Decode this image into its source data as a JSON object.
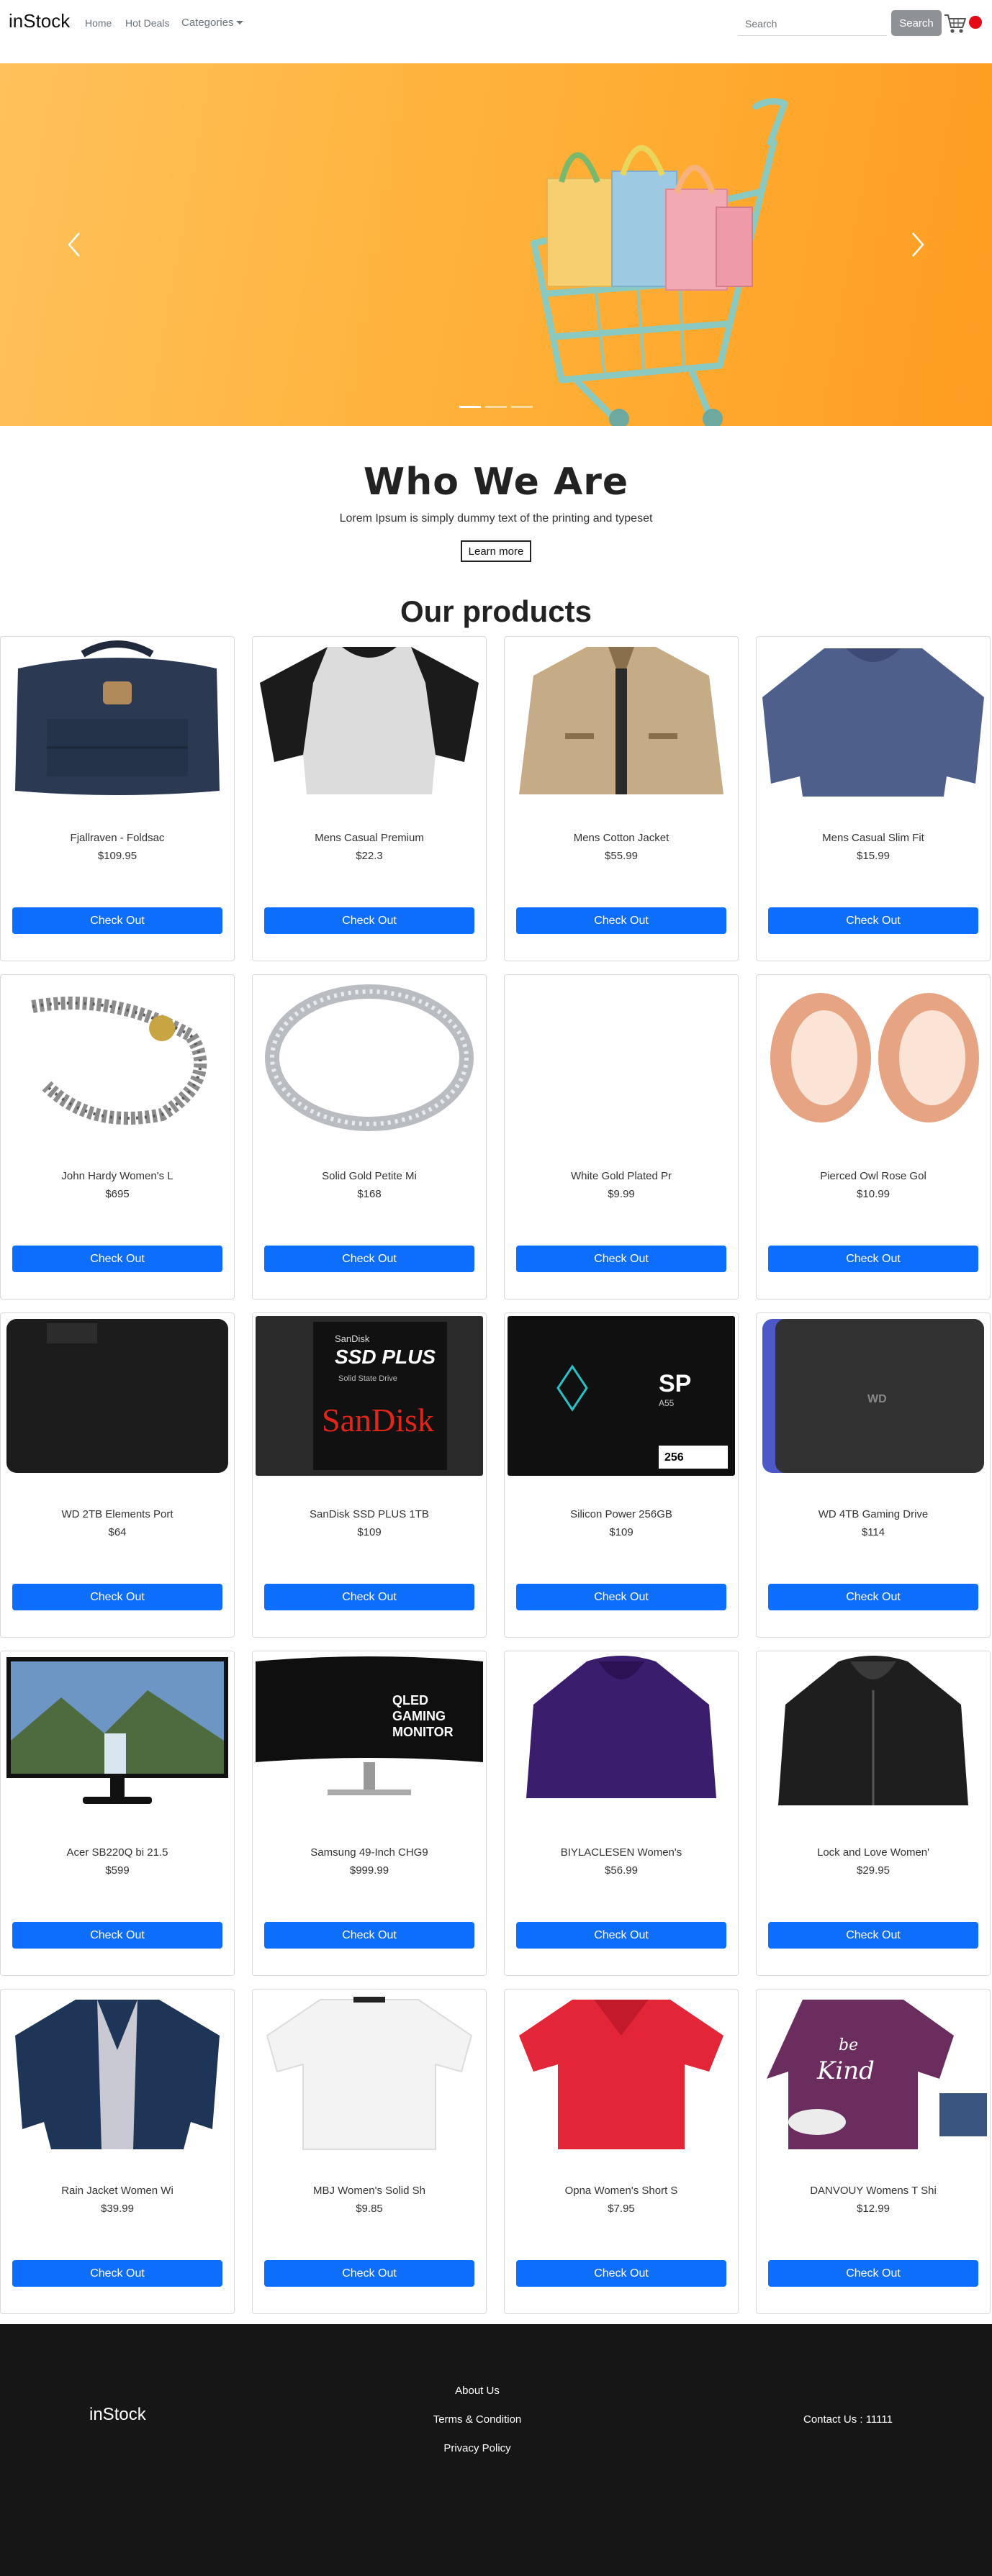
{
  "navbar": {
    "brand": "inStock",
    "links": {
      "home": "Home",
      "hot_deals": "Hot Deals",
      "categories": "Categories"
    },
    "search_placeholder": "Search",
    "search_button": "Search"
  },
  "about": {
    "title": "Who We Are",
    "text": "Lorem Ipsum is simply dummy text of the printing and typeset",
    "button": "Learn more"
  },
  "products_heading": "Our products",
  "checkout_label": "Check Out",
  "products": [
    {
      "title": "Fjallraven - Foldsac",
      "price": "$109.95"
    },
    {
      "title": "Mens Casual Premium",
      "price": "$22.3"
    },
    {
      "title": "Mens Cotton Jacket",
      "price": "$55.99"
    },
    {
      "title": "Mens Casual Slim Fit",
      "price": "$15.99"
    },
    {
      "title": "John Hardy Women's L",
      "price": "$695"
    },
    {
      "title": "Solid Gold Petite Mi",
      "price": "$168"
    },
    {
      "title": "White Gold Plated Pr",
      "price": "$9.99"
    },
    {
      "title": "Pierced Owl Rose Gol",
      "price": "$10.99"
    },
    {
      "title": "WD 2TB Elements Port",
      "price": "$64"
    },
    {
      "title": "SanDisk SSD PLUS 1TB",
      "price": "$109"
    },
    {
      "title": "Silicon Power 256GB",
      "price": "$109"
    },
    {
      "title": "WD 4TB Gaming Drive",
      "price": "$114"
    },
    {
      "title": "Acer SB220Q bi 21.5",
      "price": "$599"
    },
    {
      "title": "Samsung 49-Inch CHG9",
      "price": "$999.99"
    },
    {
      "title": "BIYLACLESEN Women's",
      "price": "$56.99"
    },
    {
      "title": "Lock and Love Women'",
      "price": "$29.95"
    },
    {
      "title": "Rain Jacket Women Wi",
      "price": "$39.99"
    },
    {
      "title": "MBJ Women's Solid Sh",
      "price": "$9.85"
    },
    {
      "title": "Opna Women's Short S",
      "price": "$7.95"
    },
    {
      "title": "DANVOUY Womens T Shi",
      "price": "$12.99"
    }
  ],
  "product_image_text": {
    "ssd_brand": "SanDisk",
    "ssd_model": "SSD PLUS",
    "ssd_sub": "Solid State Drive",
    "ssd_logo": "SanDisk",
    "sp_logo": "SP",
    "sp_model": "A55",
    "sp_capacity": "256",
    "wd_logo": "WD",
    "monitor_text_1": "QLED",
    "monitor_text_2": "GAMING",
    "monitor_text_3": "MONITOR",
    "tshirt_text_1": "be",
    "tshirt_text_2": "Kind"
  },
  "footer": {
    "brand": "inStock",
    "links": {
      "about": "About Us",
      "terms": "Terms & Condition",
      "privacy": "Privacy Policy"
    },
    "contact": "Contact Us : 11111"
  },
  "colors": {
    "primary": "#0d6efd",
    "search_button": "#8e9296",
    "cart_badge": "#e40914",
    "footer_bg": "#161616",
    "hero_orange": "#ffb33c"
  },
  "icons": {
    "cart": "shopping-cart-icon",
    "prev": "chevron-left-icon",
    "next": "chevron-right-icon",
    "categories": "caret-down-icon"
  }
}
